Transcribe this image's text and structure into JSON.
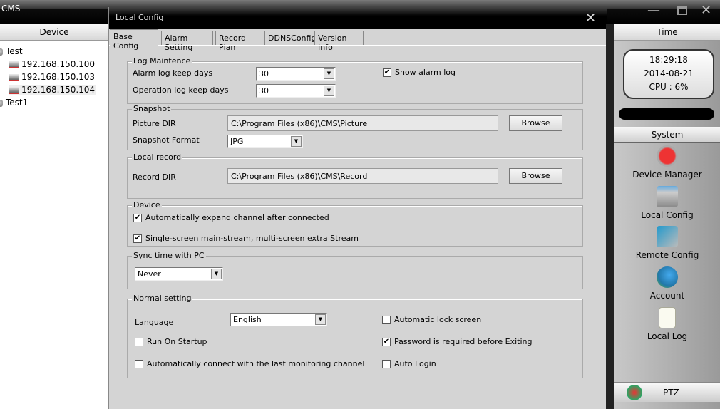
{
  "app": {
    "title": "CMS"
  },
  "left_panel": {
    "header": "Device",
    "tree": [
      {
        "label": "Test",
        "type": "group"
      },
      {
        "label": "192.168.150.100",
        "type": "device"
      },
      {
        "label": "192.168.150.103",
        "type": "device"
      },
      {
        "label": "192.168.150.104",
        "type": "device",
        "selected": true
      },
      {
        "label": "Test1",
        "type": "group"
      }
    ]
  },
  "dialog": {
    "title": "Local Config",
    "tabs": [
      "Base Config",
      "Alarm Setting",
      "Record Plan",
      "DDNSConfig",
      "Version Info"
    ],
    "active_tab": "Base Config",
    "log": {
      "title": "Log Maintence",
      "alarm_label": "Alarm log keep days",
      "alarm_value": "30",
      "op_label": "Operation log keep days",
      "op_value": "30",
      "show_alarm_log": "Show alarm log",
      "show_alarm_log_checked": true
    },
    "snapshot": {
      "title": "Snapshot",
      "dir_label": "Picture DIR",
      "dir_value": "C:\\Program Files (x86)\\CMS\\Picture",
      "browse": "Browse",
      "format_label": "Snapshot Format",
      "format_value": "JPG"
    },
    "record": {
      "title": "Local record",
      "dir_label": "Record DIR",
      "dir_value": "C:\\Program Files (x86)\\CMS\\Record",
      "browse": "Browse"
    },
    "device": {
      "title": "Device",
      "expand": "Automatically expand channel after connected",
      "expand_checked": true,
      "stream": "Single-screen main-stream, multi-screen extra Stream",
      "stream_checked": true
    },
    "sync": {
      "title": "Sync time with PC",
      "value": "Never"
    },
    "normal": {
      "title": "Normal setting",
      "language_label": "Language",
      "language_value": "English",
      "auto_lock": "Automatic lock screen",
      "auto_lock_checked": false,
      "run_startup": "Run On Startup",
      "run_startup_checked": false,
      "password_exit": "Password is required before Exiting",
      "password_exit_checked": true,
      "auto_connect": "Automatically connect with the last monitoring channel",
      "auto_connect_checked": false,
      "auto_login": "Auto Login",
      "auto_login_checked": false
    }
  },
  "right_panel": {
    "header": "Time",
    "time": "18:29:18",
    "date": "2014-08-21",
    "cpu": "CPU : 6%",
    "system_header": "System",
    "items": [
      "Device Manager",
      "Local Config",
      "Remote Config",
      "Account",
      "Local Log"
    ],
    "ptz": "PTZ"
  }
}
